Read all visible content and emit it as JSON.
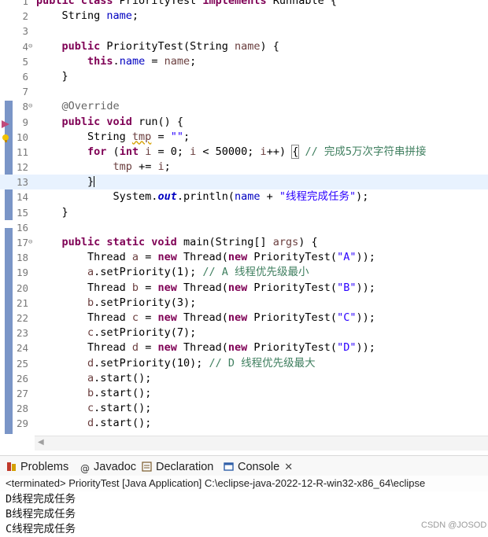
{
  "editor": {
    "lines": [
      {
        "n": "1",
        "tokens": [
          [
            "kw",
            "public class "
          ],
          [
            "",
            "PriorityTest "
          ],
          [
            "kw",
            "implements "
          ],
          [
            "",
            "Runnable {"
          ]
        ]
      },
      {
        "n": "2",
        "tokens": [
          [
            "",
            "    String "
          ],
          [
            "fld",
            "name"
          ],
          [
            "",
            ";"
          ]
        ]
      },
      {
        "n": "3",
        "tokens": []
      },
      {
        "n": "4",
        "fold": "⊖",
        "tokens": [
          [
            "",
            "    "
          ],
          [
            "kw",
            "public "
          ],
          [
            "",
            "PriorityTest(String "
          ],
          [
            "var",
            "name"
          ],
          [
            "",
            ") {"
          ]
        ]
      },
      {
        "n": "5",
        "tokens": [
          [
            "",
            "        "
          ],
          [
            "kw",
            "this"
          ],
          [
            "",
            "."
          ],
          [
            "fld",
            "name"
          ],
          [
            "",
            " = "
          ],
          [
            "var",
            "name"
          ],
          [
            "",
            ";"
          ]
        ]
      },
      {
        "n": "6",
        "tokens": [
          [
            "",
            "    }"
          ]
        ]
      },
      {
        "n": "7",
        "tokens": []
      },
      {
        "n": "8",
        "fold": "⊖",
        "tokens": [
          [
            "",
            "    "
          ],
          [
            "ann",
            "@Override"
          ]
        ]
      },
      {
        "n": "9",
        "tokens": [
          [
            "",
            "    "
          ],
          [
            "kw",
            "public void "
          ],
          [
            "",
            "run() {"
          ]
        ]
      },
      {
        "n": "10",
        "tokens": [
          [
            "",
            "        String "
          ],
          [
            "var warn",
            "tmp"
          ],
          [
            "",
            " = "
          ],
          [
            "str",
            "\"\""
          ],
          [
            "",
            ";"
          ]
        ]
      },
      {
        "n": "11",
        "tokens": [
          [
            "",
            "        "
          ],
          [
            "kw",
            "for "
          ],
          [
            "",
            "("
          ],
          [
            "kw",
            "int "
          ],
          [
            "var",
            "i"
          ],
          [
            "",
            " = 0; "
          ],
          [
            "var",
            "i"
          ],
          [
            "",
            " < 50000; "
          ],
          [
            "var",
            "i"
          ],
          [
            "",
            "++) "
          ],
          [
            "brk",
            "{"
          ],
          [
            "cmt",
            " // 完成5万次字符串拼接"
          ]
        ]
      },
      {
        "n": "12",
        "tokens": [
          [
            "",
            "            "
          ],
          [
            "var",
            "tmp"
          ],
          [
            "",
            " += "
          ],
          [
            "var",
            "i"
          ],
          [
            "",
            ";"
          ]
        ]
      },
      {
        "n": "13",
        "current": true,
        "tokens": [
          [
            "",
            "        }"
          ],
          [
            "caret",
            ""
          ]
        ]
      },
      {
        "n": "14",
        "tokens": [
          [
            "",
            "            System."
          ],
          [
            "sfld",
            "out"
          ],
          [
            "",
            ".println("
          ],
          [
            "fld",
            "name"
          ],
          [
            "",
            " + "
          ],
          [
            "str",
            "\"线程完成任务\""
          ],
          [
            "",
            ");"
          ]
        ]
      },
      {
        "n": "15",
        "tokens": [
          [
            "",
            "    }"
          ]
        ]
      },
      {
        "n": "16",
        "tokens": []
      },
      {
        "n": "17",
        "fold": "⊖",
        "tokens": [
          [
            "",
            "    "
          ],
          [
            "kw",
            "public static void "
          ],
          [
            "",
            "main(String[] "
          ],
          [
            "var",
            "args"
          ],
          [
            "",
            ") {"
          ]
        ]
      },
      {
        "n": "18",
        "tokens": [
          [
            "",
            "        Thread "
          ],
          [
            "var",
            "a"
          ],
          [
            "",
            " = "
          ],
          [
            "kw",
            "new "
          ],
          [
            "",
            "Thread("
          ],
          [
            "kw",
            "new "
          ],
          [
            "",
            "PriorityTest("
          ],
          [
            "str",
            "\"A\""
          ],
          [
            "",
            "));"
          ]
        ]
      },
      {
        "n": "19",
        "tokens": [
          [
            "",
            "        "
          ],
          [
            "var",
            "a"
          ],
          [
            "",
            ".setPriority(1); "
          ],
          [
            "cmt",
            "// A 线程优先级最小"
          ]
        ]
      },
      {
        "n": "20",
        "tokens": [
          [
            "",
            "        Thread "
          ],
          [
            "var",
            "b"
          ],
          [
            "",
            " = "
          ],
          [
            "kw",
            "new "
          ],
          [
            "",
            "Thread("
          ],
          [
            "kw",
            "new "
          ],
          [
            "",
            "PriorityTest("
          ],
          [
            "str",
            "\"B\""
          ],
          [
            "",
            "));"
          ]
        ]
      },
      {
        "n": "21",
        "tokens": [
          [
            "",
            "        "
          ],
          [
            "var",
            "b"
          ],
          [
            "",
            ".setPriority(3);"
          ]
        ]
      },
      {
        "n": "22",
        "tokens": [
          [
            "",
            "        Thread "
          ],
          [
            "var",
            "c"
          ],
          [
            "",
            " = "
          ],
          [
            "kw",
            "new "
          ],
          [
            "",
            "Thread("
          ],
          [
            "kw",
            "new "
          ],
          [
            "",
            "PriorityTest("
          ],
          [
            "str",
            "\"C\""
          ],
          [
            "",
            "));"
          ]
        ]
      },
      {
        "n": "23",
        "tokens": [
          [
            "",
            "        "
          ],
          [
            "var",
            "c"
          ],
          [
            "",
            ".setPriority(7);"
          ]
        ]
      },
      {
        "n": "24",
        "tokens": [
          [
            "",
            "        Thread "
          ],
          [
            "var",
            "d"
          ],
          [
            "",
            " = "
          ],
          [
            "kw",
            "new "
          ],
          [
            "",
            "Thread("
          ],
          [
            "kw",
            "new "
          ],
          [
            "",
            "PriorityTest("
          ],
          [
            "str",
            "\"D\""
          ],
          [
            "",
            "));"
          ]
        ]
      },
      {
        "n": "25",
        "tokens": [
          [
            "",
            "        "
          ],
          [
            "var",
            "d"
          ],
          [
            "",
            ".setPriority(10); "
          ],
          [
            "cmt",
            "// D 线程优先级最大"
          ]
        ]
      },
      {
        "n": "26",
        "tokens": [
          [
            "",
            "        "
          ],
          [
            "var",
            "a"
          ],
          [
            "",
            ".start();"
          ]
        ]
      },
      {
        "n": "27",
        "tokens": [
          [
            "",
            "        "
          ],
          [
            "var",
            "b"
          ],
          [
            "",
            ".start();"
          ]
        ]
      },
      {
        "n": "28",
        "tokens": [
          [
            "",
            "        "
          ],
          [
            "var",
            "c"
          ],
          [
            "",
            ".start();"
          ]
        ]
      },
      {
        "n": "29",
        "tokens": [
          [
            "",
            "        "
          ],
          [
            "var",
            "d"
          ],
          [
            "",
            ".start();"
          ]
        ]
      }
    ]
  },
  "tabs": {
    "problems": "Problems",
    "javadoc": "Javadoc",
    "declaration": "Declaration",
    "console": "Console",
    "close": "✕"
  },
  "console": {
    "status": "<terminated> PriorityTest [Java Application] C:\\eclipse-java-2022-12-R-win32-x86_64\\eclipse",
    "output": [
      "D线程完成任务",
      "B线程完成任务",
      "C线程完成任务"
    ]
  },
  "watermark": "CSDN @JOSOD",
  "colors": {
    "keyword": "#7f0055",
    "string": "#2a00ff",
    "comment": "#3f7f5f",
    "field": "#0000c0",
    "gutter": "#7a95c7"
  }
}
